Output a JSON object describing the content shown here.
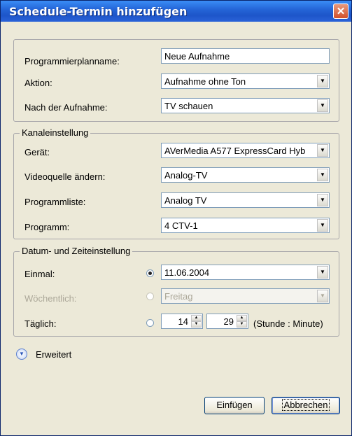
{
  "window": {
    "title": "Schedule-Termin hinzufügen",
    "close": "✕"
  },
  "general": {
    "name_label": "Programmierplanname:",
    "name_value": "Neue Aufnahme",
    "action_label": "Aktion:",
    "action_value": "Aufnahme ohne Ton",
    "after_label": "Nach der Aufnahme:",
    "after_value": "TV schauen"
  },
  "channel": {
    "group_title": "Kanaleinstellung",
    "device_label": "Gerät:",
    "device_value": "AVerMedia A577 ExpressCard Hyb",
    "source_label": "Videoquelle ändern:",
    "source_value": "Analog-TV",
    "list_label": "Programmliste:",
    "list_value": "Analog TV",
    "program_label": "Programm:",
    "program_value": "4 CTV-1"
  },
  "datetime": {
    "group_title": "Datum- und Zeiteinstellung",
    "once_label": "Einmal:",
    "once_value": "11.06.2004",
    "weekly_label": "Wöchentlich:",
    "weekly_value": "Freitag",
    "daily_label": "Täglich:",
    "hour_value": "14",
    "minute_value": "29",
    "time_hint": "(Stunde : Minute)",
    "selected_mode": "Einmal"
  },
  "expand": {
    "label": "Erweitert"
  },
  "buttons": {
    "insert": "Einfügen",
    "cancel": "Abbrechen"
  }
}
